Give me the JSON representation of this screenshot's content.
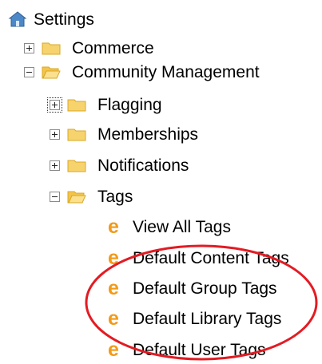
{
  "tree": {
    "root": {
      "label": "Settings",
      "icon": "settings-home-icon"
    },
    "nodes": [
      {
        "label": "Commerce",
        "toggle": "plus",
        "icon": "folder-closed-icon"
      },
      {
        "label": "Community Management",
        "toggle": "minus",
        "icon": "folder-open-icon"
      },
      {
        "label": "Flagging",
        "toggle": "plus",
        "icon": "folder-closed-icon"
      },
      {
        "label": "Memberships",
        "toggle": "plus",
        "icon": "folder-closed-icon"
      },
      {
        "label": "Notifications",
        "toggle": "plus",
        "icon": "folder-closed-icon"
      },
      {
        "label": "Tags",
        "toggle": "minus",
        "icon": "folder-open-icon"
      }
    ],
    "leaves": [
      {
        "glyph": "e",
        "label": "View All Tags"
      },
      {
        "glyph": "e",
        "label": "Default Content Tags"
      },
      {
        "glyph": "e",
        "label": "Default Group Tags"
      },
      {
        "glyph": "e",
        "label": "Default Library Tags"
      },
      {
        "glyph": "e",
        "label": "Default User Tags"
      }
    ]
  },
  "colors": {
    "leaf_icon": "#f39a17",
    "folder_fill": "#f7d36e",
    "annotation_circle": "#e31b23"
  }
}
